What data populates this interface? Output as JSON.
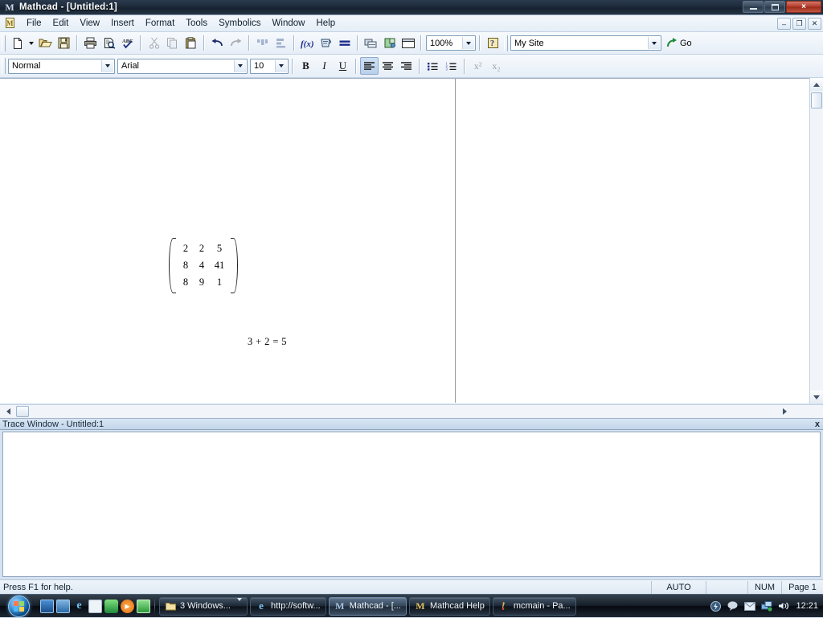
{
  "window": {
    "title": "Mathcad - [Untitled:1]",
    "app_icon": "mathcad-m-icon",
    "controls": {
      "minimize": "minimize-icon",
      "restore": "restore-icon",
      "close": "×"
    }
  },
  "menubar": {
    "items": [
      {
        "label": "File"
      },
      {
        "label": "Edit"
      },
      {
        "label": "View"
      },
      {
        "label": "Insert"
      },
      {
        "label": "Format"
      },
      {
        "label": "Tools"
      },
      {
        "label": "Symbolics"
      },
      {
        "label": "Window"
      },
      {
        "label": "Help"
      }
    ]
  },
  "standard_toolbar": {
    "buttons": [
      {
        "name": "new-document-button",
        "icon": "new-page-icon",
        "disabled": false
      },
      {
        "name": "new-document-dropdown",
        "icon": "chevron-down-icon",
        "disabled": false
      },
      {
        "name": "open-button",
        "icon": "open-folder-icon",
        "disabled": false
      },
      {
        "name": "save-button",
        "icon": "floppy-disk-icon",
        "disabled": false
      },
      {
        "name": "print-button",
        "icon": "printer-icon",
        "disabled": false
      },
      {
        "name": "print-preview-button",
        "icon": "print-preview-icon",
        "disabled": false
      },
      {
        "name": "check-spelling-button",
        "icon": "abc-check-icon",
        "disabled": false
      },
      {
        "name": "cut-button",
        "icon": "scissors-icon",
        "disabled": true
      },
      {
        "name": "copy-button",
        "icon": "copy-icon",
        "disabled": true
      },
      {
        "name": "paste-button",
        "icon": "clipboard-paste-icon",
        "disabled": false
      },
      {
        "name": "undo-button",
        "icon": "undo-arrow-icon",
        "disabled": false
      },
      {
        "name": "redo-button",
        "icon": "redo-arrow-icon",
        "disabled": true
      },
      {
        "name": "align-across-button",
        "icon": "align-across-icon",
        "disabled": true
      },
      {
        "name": "align-down-button",
        "icon": "align-down-icon",
        "disabled": true
      },
      {
        "name": "insert-function-button",
        "icon": "fx-function-icon",
        "disabled": false
      },
      {
        "name": "insert-unit-button",
        "icon": "measuring-cup-icon",
        "disabled": false
      },
      {
        "name": "calculate-button",
        "icon": "equals-calculate-icon",
        "disabled": false
      },
      {
        "name": "insert-hyperlink-button",
        "icon": "hyperlink-icon",
        "disabled": false
      },
      {
        "name": "insert-component-button",
        "icon": "component-puzzle-icon",
        "disabled": false
      },
      {
        "name": "insert-area-button",
        "icon": "insert-area-icon",
        "disabled": false
      }
    ],
    "zoom": {
      "value": "100%",
      "name": "zoom-combo"
    },
    "help_button": {
      "name": "context-help-button",
      "icon": "question-mark-icon"
    },
    "site": {
      "value": "My Site",
      "name": "site-combo"
    },
    "go": {
      "label": "Go",
      "icon": "go-arrow-icon"
    }
  },
  "formatting_toolbar": {
    "style": {
      "value": "Normal",
      "name": "paragraph-style-combo"
    },
    "font": {
      "value": "Arial",
      "name": "font-family-combo"
    },
    "size": {
      "value": "10",
      "name": "font-size-combo"
    },
    "buttons": [
      {
        "name": "bold-button",
        "label": "B",
        "active": false,
        "disabled": false
      },
      {
        "name": "italic-button",
        "label": "I",
        "active": false,
        "disabled": false
      },
      {
        "name": "underline-button",
        "label": "U",
        "active": false,
        "disabled": false
      },
      {
        "name": "align-left-button",
        "icon": "align-left-icon",
        "active": true,
        "disabled": false
      },
      {
        "name": "align-center-button",
        "icon": "align-center-icon",
        "active": false,
        "disabled": false
      },
      {
        "name": "align-right-button",
        "icon": "align-right-icon",
        "active": false,
        "disabled": false
      },
      {
        "name": "bullet-list-button",
        "icon": "bullet-list-icon",
        "active": false,
        "disabled": false
      },
      {
        "name": "numbered-list-button",
        "icon": "numbered-list-icon",
        "active": false,
        "disabled": false
      },
      {
        "name": "superscript-button",
        "label": "x²",
        "active": false,
        "disabled": true
      },
      {
        "name": "subscript-button",
        "label": "x₂",
        "active": false,
        "disabled": true
      }
    ]
  },
  "mdi_controls": {
    "minimize": "–",
    "restore": "❐",
    "close": "✕"
  },
  "document": {
    "matrix": {
      "rows": [
        [
          "2",
          "2",
          "5"
        ],
        [
          "8",
          "4",
          "41"
        ],
        [
          "8",
          "9",
          "1"
        ]
      ]
    },
    "equation": "3 + 2 = 5",
    "cursor": "red-crosshair-cursor"
  },
  "trace_window": {
    "title": "Trace Window - Untitled:1",
    "close_label": "x",
    "content": ""
  },
  "statusbar": {
    "message": "Press F1 for help.",
    "auto": "AUTO",
    "num": "NUM",
    "page": "Page 1"
  },
  "taskbar": {
    "start": "windows-start-orb",
    "quick_launch": [
      {
        "name": "show-desktop-icon"
      },
      {
        "name": "switch-windows-icon"
      },
      {
        "name": "internet-explorer-icon"
      },
      {
        "name": "outlook-express-icon"
      },
      {
        "name": "media-sync-icon"
      },
      {
        "name": "windows-media-player-icon"
      },
      {
        "name": "green-app-icon"
      }
    ],
    "tasks": [
      {
        "name": "task-windows-explorer",
        "label": "3 Windows...",
        "icon": "folder-icon",
        "active": false,
        "has_caret": true
      },
      {
        "name": "task-internet-explorer",
        "label": "http://softw...",
        "icon": "internet-explorer-icon",
        "active": false,
        "has_caret": false
      },
      {
        "name": "task-mathcad",
        "label": "Mathcad - [...",
        "icon": "mathcad-m-icon",
        "active": true,
        "has_caret": false
      },
      {
        "name": "task-mathcad-help",
        "label": "Mathcad Help",
        "icon": "mathcad-help-icon",
        "active": false,
        "has_caret": false
      },
      {
        "name": "task-mcmain-paint",
        "label": "mcmain - Pa...",
        "icon": "paint-icon",
        "active": false,
        "has_caret": false
      }
    ],
    "tray": [
      {
        "name": "tray-action-center-icon"
      },
      {
        "name": "tray-messenger-icon"
      },
      {
        "name": "tray-mail-icon"
      },
      {
        "name": "tray-network-icon"
      },
      {
        "name": "tray-volume-icon"
      }
    ],
    "clock": "12:21"
  },
  "colors": {
    "accent": "#1d2b3c",
    "page": "#ffffff",
    "cursor_red": "#8b1a1a",
    "trace_header": "#c2d6ea"
  }
}
